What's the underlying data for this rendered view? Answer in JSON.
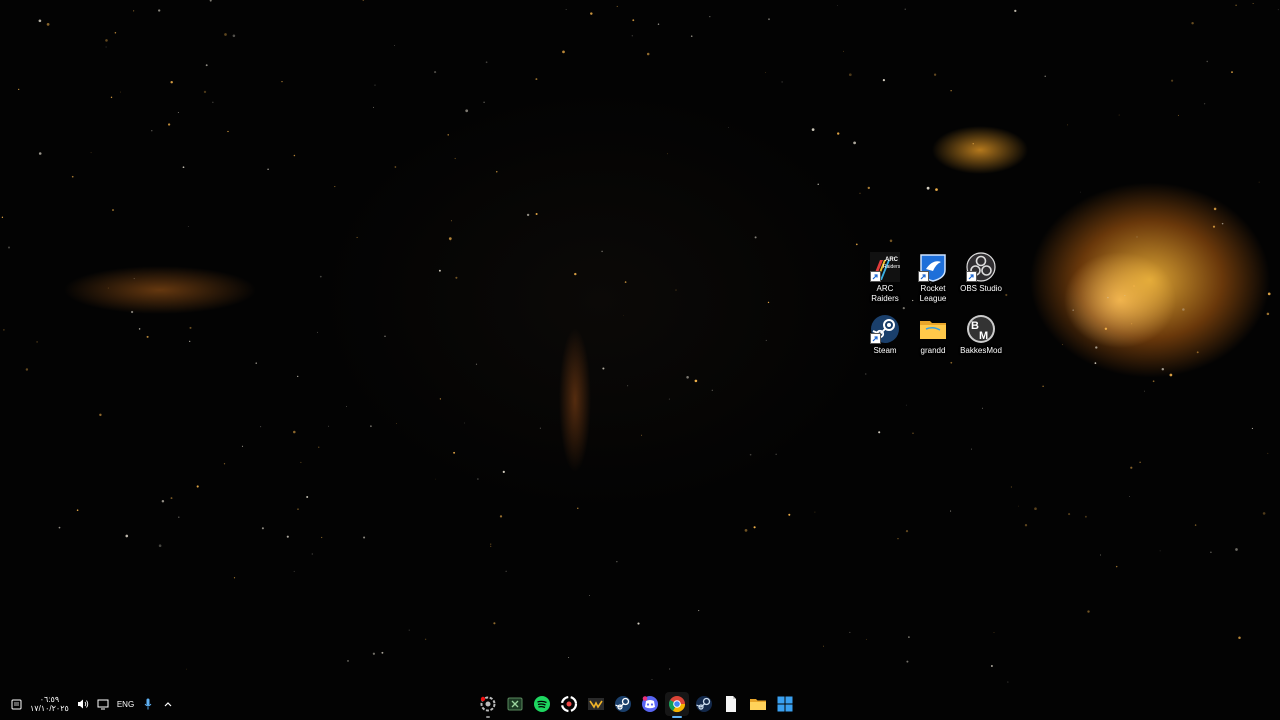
{
  "desktop": {
    "icons": [
      {
        "label": "ARC Raiders",
        "icon": "arc-raiders-icon",
        "shortcut": true
      },
      {
        "label": "Rocket League",
        "icon": "rocket-league-icon",
        "shortcut": true
      },
      {
        "label": "OBS Studio",
        "icon": "obs-studio-icon",
        "shortcut": true
      },
      {
        "label": "Steam",
        "icon": "steam-icon",
        "shortcut": true
      },
      {
        "label": "grandd",
        "icon": "folder-icon",
        "shortcut": false
      },
      {
        "label": "BakkesMod",
        "icon": "bakkesmod-icon",
        "shortcut": false
      }
    ],
    "arc_logo_text": "ARC Raiders"
  },
  "taskbar": {
    "clock_time": "٠٦:٥٩",
    "clock_date": "١٧/١٠/٢٠٢٥",
    "language": "ENG",
    "tray_icons": [
      "notification-icon",
      "volume-icon",
      "display-icon",
      "microphone-icon",
      "chevron-up-icon"
    ],
    "pinned_apps": [
      "settings-gear-icon",
      "xbox-icon",
      "spotify-icon",
      "epic-icon",
      "game-icon",
      "steam-icon",
      "discord-icon",
      "chrome-icon",
      "steam-icon",
      "notepad-icon",
      "file-explorer-icon",
      "start-icon"
    ],
    "accent_color": "#5fb2f5"
  }
}
